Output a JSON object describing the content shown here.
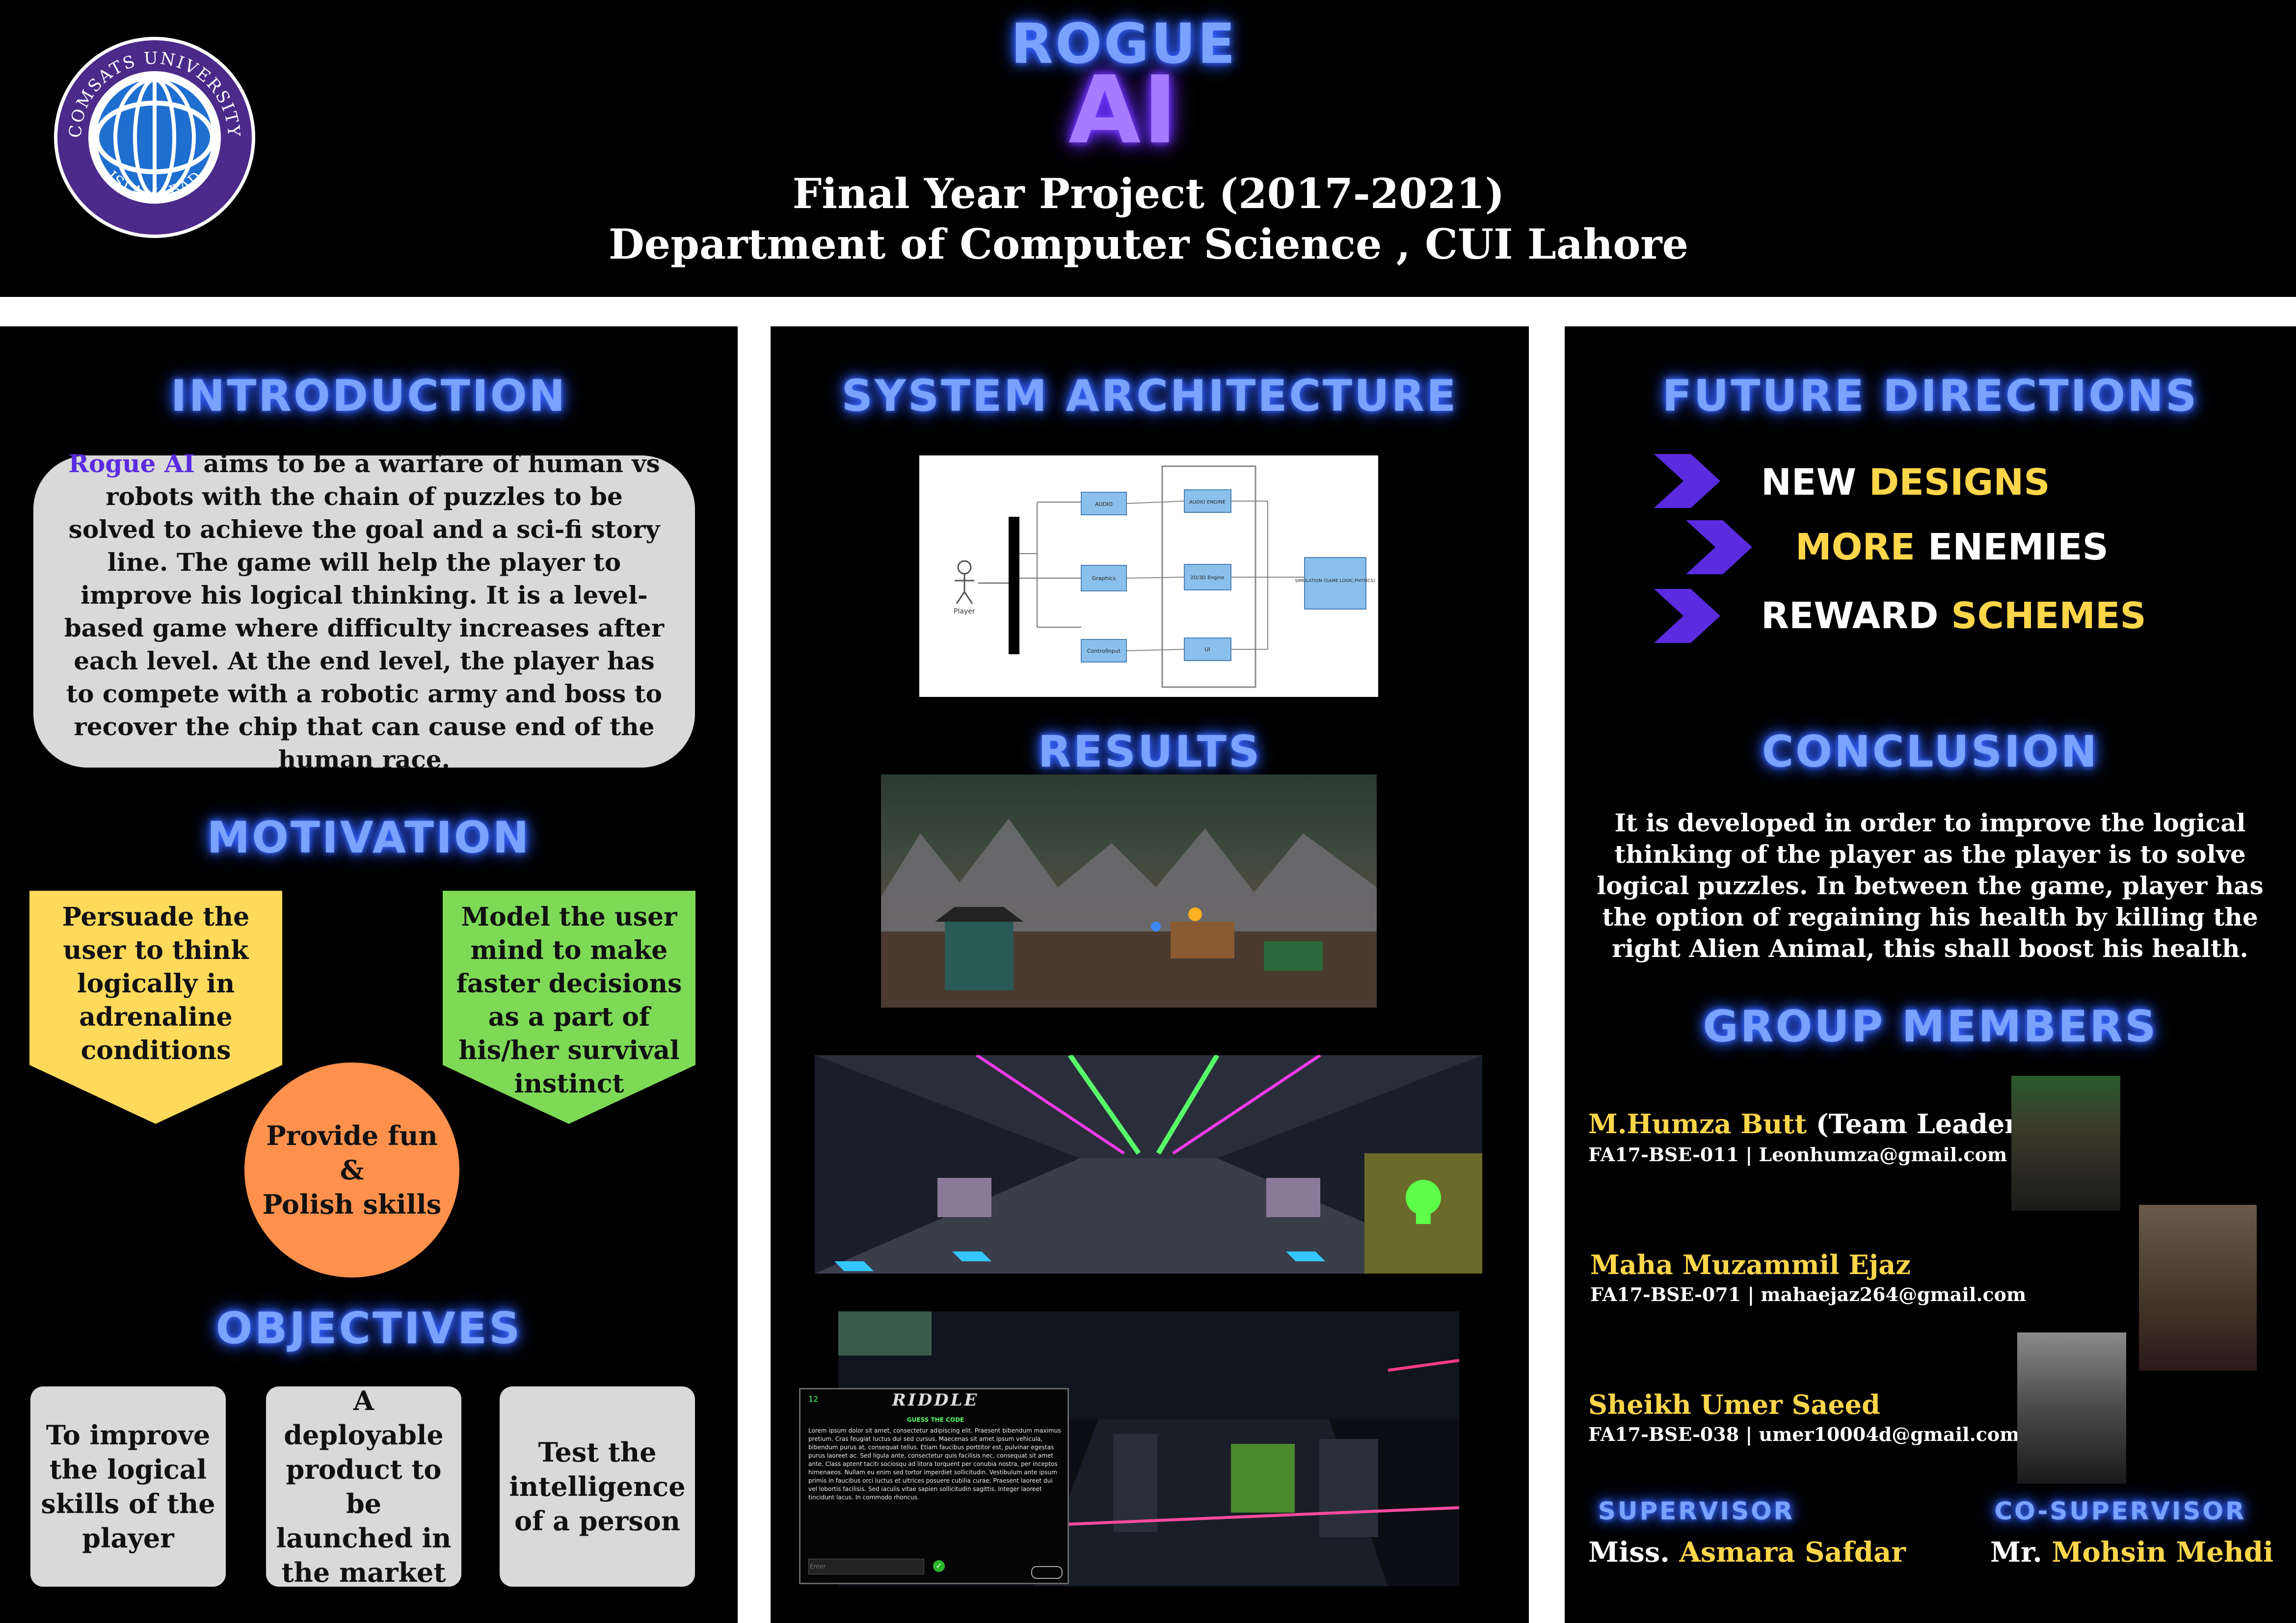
{
  "header": {
    "title_line1": "ROGUE",
    "title_line2": "AI",
    "subtitle1": "Final Year Project (2017-2021)",
    "subtitle2": "Department of Computer Science , CUI Lahore",
    "logo": {
      "top_text": "COMSATS UNIVERSITY",
      "bottom_text": "ISLAMABAD"
    }
  },
  "introduction": {
    "heading": "INTRODUCTION",
    "highlight": "Rogue AI",
    "text": " aims to be a warfare of human vs robots with the chain of puzzles to be solved to achieve the goal and a sci-fi story line. The game will help the player to improve his logical thinking. It is a level-based game where difficulty increases after each level. At the end level, the player has to compete with a robotic army and boss to recover the chip that can cause end of the human race."
  },
  "motivation": {
    "heading": "MOTIVATION",
    "left": "Persuade the user to think logically in adrenaline conditions",
    "right": "Model the user mind to make faster decisions as a part of his/her survival instinct",
    "circle_line1": "Provide fun",
    "circle_line2": "&",
    "circle_line3": "Polish skills"
  },
  "objectives": {
    "heading": "OBJECTIVES",
    "items": [
      "To improve the logical skills of the player",
      "A deployable product to be launched in the market",
      "Test the intelligence of a person"
    ]
  },
  "architecture": {
    "heading": "SYSTEM ARCHITECTURE",
    "actor": "Player",
    "boxes": [
      "AUDIO",
      "Graphics",
      "ControlInput",
      "AUDIO ENGINE",
      "2D/3D Engine",
      "UI",
      "SIMULATION (GAME LOGIC,PHYSICS)"
    ]
  },
  "results": {
    "heading": "RESULTS",
    "riddle": {
      "title": "RIDDLE",
      "counter": "12",
      "subtitle": "GUESS THE CODE",
      "body": "Lorem ipsum dolor sit amet, consectetur adipiscing elit. Praesent bibendum maximus pretium. Cras feugiat luctus dui sed cursus. Maecenas sit amet ipsum vehicula, bibendum purus at, consequat tellus. Etiam faucibus porttitor est, pulvinar egestas purus laoreet ac. Sed ligula ante, consectetur quis facilisis nec, consequat sit amet ante. Class aptent taciti sociosqu ad litora torquent per conubia nostra, per inceptos himenaeos. Nullam eu enim sed tortor imperdiet sollicitudin. Vestibulum ante ipsum primis in faucibus orci luctus et ultrices posuere cubilia curae; Praesent laoreet dui vel lobortis facilisis. Sed iaculis vitae sapien sollicitudin sagittis. Integer laoreet tincidunt lacus. In commodo rhoncus.",
      "input_placeholder": "Enter"
    }
  },
  "future": {
    "heading": "FUTURE DIRECTIONS",
    "items": [
      {
        "a": "NEW ",
        "b": "DESIGNS"
      },
      {
        "a": "MORE ",
        "b": "ENEMIES"
      },
      {
        "a": "REWARD ",
        "b": "SCHEMES"
      }
    ]
  },
  "conclusion": {
    "heading": "CONCLUSION",
    "text": "It is developed in order to improve the logical thinking of the player as the player is to solve logical puzzles. In between the game, player has the option of regaining his health by killing the right Alien Animal, this shall boost his health."
  },
  "group": {
    "heading": "GROUP MEMBERS",
    "members": [
      {
        "name": "M.Humza Butt",
        "role": " (Team Leader)",
        "info": "FA17-BSE-011 | Leonhumza@gmail.com"
      },
      {
        "name": "Maha Muzammil Ejaz",
        "role": "",
        "info": "FA17-BSE-071 | mahaejaz264@gmail.com"
      },
      {
        "name": "Sheikh Umer Saeed",
        "role": "",
        "info": "FA17-BSE-038 | umer10004d@gmail.com"
      }
    ],
    "supervisor_label": "SUPERVISOR",
    "supervisor_prefix": "Miss. ",
    "supervisor_name": "Asmara Safdar",
    "cosupervisor_label": "CO-SUPERVISOR",
    "cosupervisor_prefix": "Mr. ",
    "cosupervisor_name": "Mohsin Mehdi"
  },
  "colors": {
    "neon_blue": "#7aa2ff",
    "title_purple": "#a77bff",
    "gold": "#ffd54a",
    "arrow_purple": "#5b2be0",
    "yellow_card": "#ffd95a",
    "green_card": "#7ed957",
    "orange_circle": "#ff914d",
    "grey_card": "#d9d9d9"
  }
}
